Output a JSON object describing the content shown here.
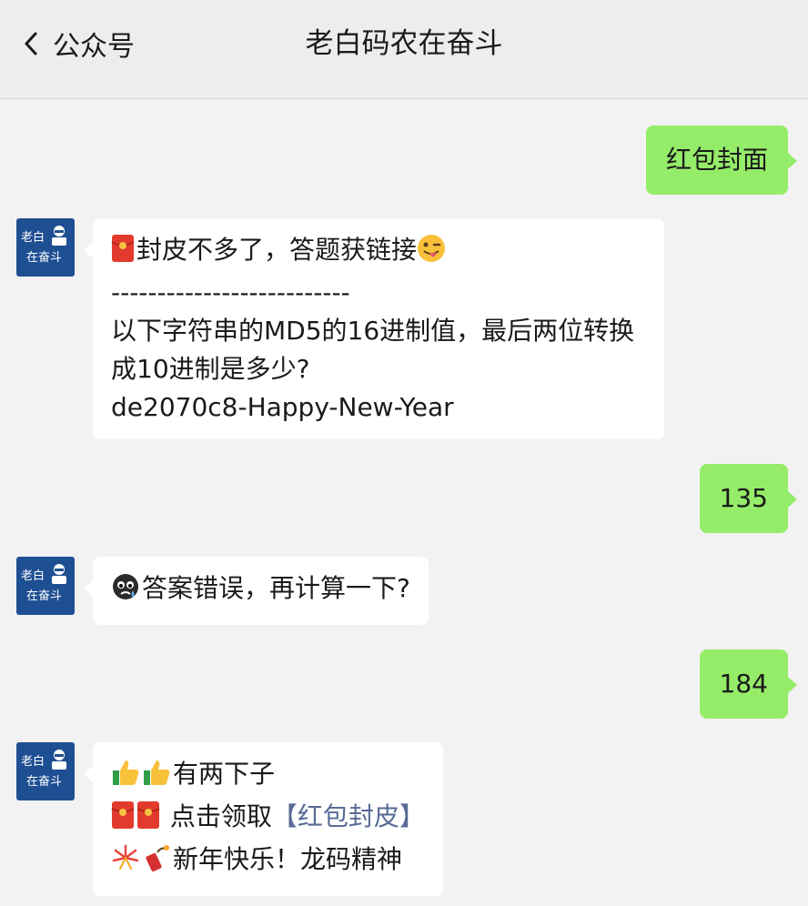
{
  "header": {
    "back_label": "公众号",
    "title": "老白码农在奋斗"
  },
  "avatar": {
    "line1": "老白",
    "line2": "在奋斗"
  },
  "messages": {
    "m1": "红包封面",
    "m2": {
      "l1": "封皮不多了，答题获链接",
      "l2": "--------------------------",
      "l3": "以下字符串的MD5的16进制值，最后两位转换",
      "l4": "成10进制是多少?",
      "l5": "de2070c8-Happy-New-Year"
    },
    "m3": "135",
    "m4": "答案错误，再计算一下?",
    "m5": "184",
    "m6": {
      "l1": "有两下子",
      "l2_prefix": " 点击领取",
      "l2_link": "【红包封皮】",
      "l3": "新年快乐！龙码精神"
    }
  },
  "colors": {
    "my_bubble": "#95ec69",
    "their_bubble": "#ffffff",
    "link": "#576b95",
    "avatar_bg": "#1f4f93"
  },
  "icons": [
    "chevron-left-icon",
    "red-envelope-icon",
    "winking-tongue-face-icon",
    "sad-face-icon",
    "thumbs-up-icon",
    "firework-icon",
    "firecracker-icon"
  ]
}
